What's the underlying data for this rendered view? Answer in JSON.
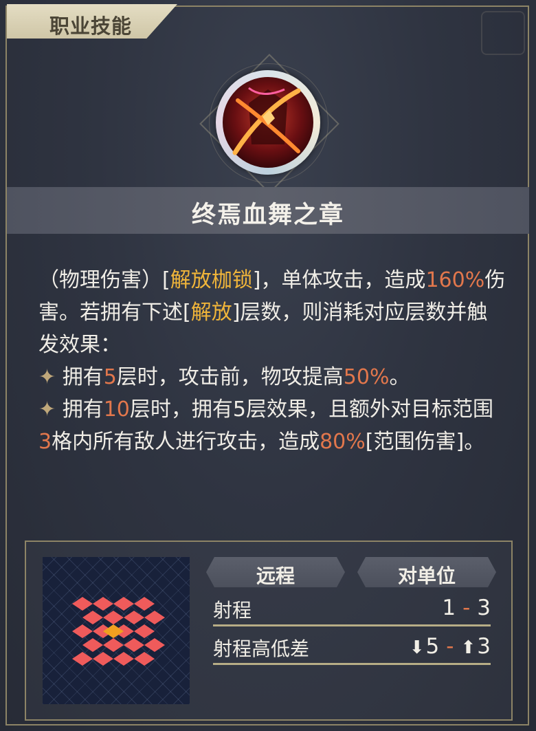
{
  "header": {
    "title": "职业技能"
  },
  "skill": {
    "name": "终焉血舞之章",
    "icon": "crimson-slash-icon"
  },
  "description": {
    "p1_a": "（物理伤害）[",
    "p1_gold1": "解放枷锁",
    "p1_b": "]，单体攻击，造成",
    "p1_num1": "160%",
    "p1_c": "伤害。若拥有下述[",
    "p1_gold2": "解放",
    "p1_d": "]层数，则消耗对应层数并触发效果：",
    "b1_a": "拥有",
    "b1_num1": "5",
    "b1_b": "层时，攻击前，物攻提高",
    "b1_num2": "50%",
    "b1_c": "。",
    "b2_a": "拥有",
    "b2_num1": "10",
    "b2_b": "层时，拥有5层效果，且额外对目标范围",
    "b2_num2": "3",
    "b2_c": "格内所有敌人进行攻击，造成",
    "b2_num3": "80%",
    "b2_d": "[范围伤害]。"
  },
  "stats": {
    "type_label": "远程",
    "target_label": "对单位",
    "range_label": "射程",
    "range_min": "1",
    "range_max": "3",
    "height_label": "射程高低差",
    "height_down": "5",
    "height_up": "3",
    "separator": "-"
  },
  "colors": {
    "gold": "#f0b53a",
    "number": "#e2774c",
    "tile_red": "#ef5b5b",
    "tile_center": "#f0a020",
    "frame": "#8d8466"
  }
}
